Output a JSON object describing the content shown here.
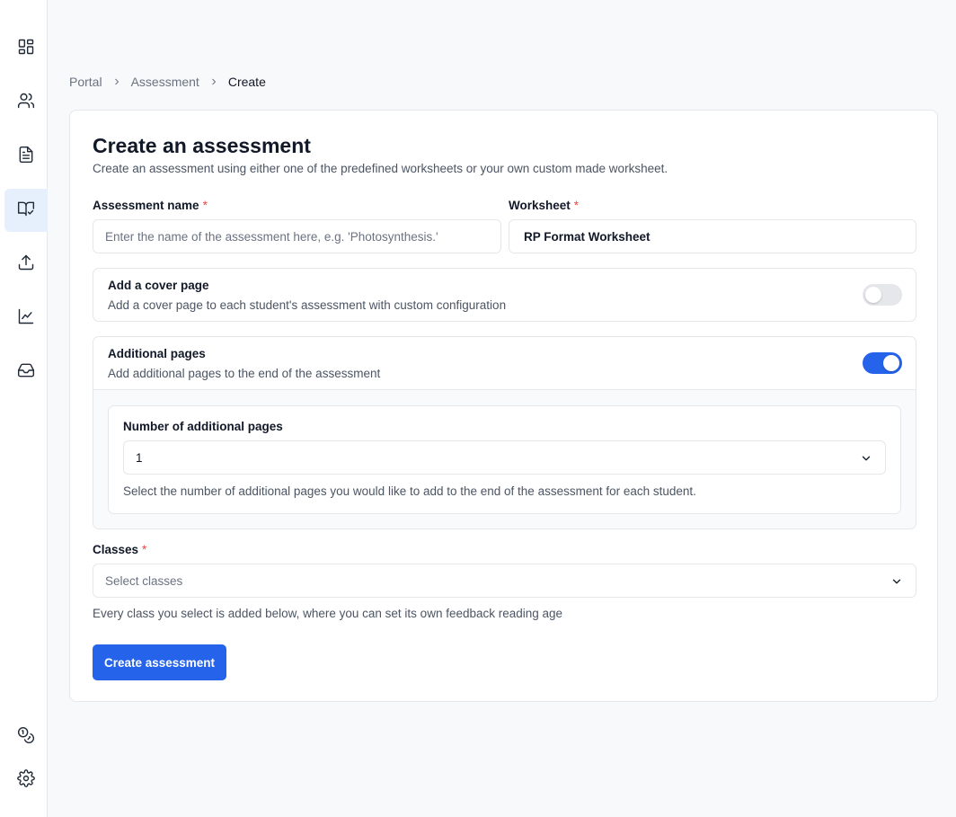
{
  "sidebar": {
    "items": [
      {
        "icon": "dashboard-grid-icon"
      },
      {
        "icon": "users-icon"
      },
      {
        "icon": "document-icon"
      },
      {
        "icon": "book-check-icon",
        "active": true
      },
      {
        "icon": "upload-icon"
      },
      {
        "icon": "line-chart-icon"
      },
      {
        "icon": "inbox-icon"
      }
    ],
    "bottom_items": [
      {
        "icon": "coins-icon"
      },
      {
        "icon": "settings-gear-icon"
      }
    ]
  },
  "breadcrumb": {
    "items": [
      "Portal",
      "Assessment"
    ],
    "current": "Create"
  },
  "form": {
    "title": "Create an assessment",
    "subtitle": "Create an assessment using either one of the predefined worksheets or your own custom made worksheet.",
    "assessment_name": {
      "label": "Assessment name",
      "required_mark": "*",
      "placeholder": "Enter the name of the assessment here, e.g. 'Photosynthesis.'",
      "value": ""
    },
    "worksheet": {
      "label": "Worksheet",
      "required_mark": "*",
      "value": "RP Format Worksheet"
    },
    "cover_page": {
      "title": "Add a cover page",
      "description": "Add a cover page to each student's assessment with custom configuration",
      "enabled": false
    },
    "additional_pages": {
      "title": "Additional pages",
      "description": "Add additional pages to the end of the assessment",
      "enabled": true,
      "count_label": "Number of additional pages",
      "count_value": "1",
      "count_hint": "Select the number of additional pages you would like to add to the end of the assessment for each student."
    },
    "classes": {
      "label": "Classes",
      "required_mark": "*",
      "placeholder": "Select classes",
      "hint": "Every class you select is added below, where you can set its own feedback reading age"
    },
    "submit_label": "Create assessment"
  },
  "colors": {
    "primary": "#2563eb",
    "active_nav_bg": "#e6effc",
    "required": "#ef4444"
  }
}
